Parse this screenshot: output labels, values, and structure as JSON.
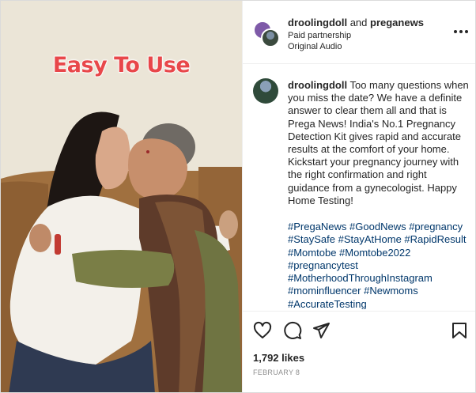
{
  "media": {
    "overlay_text": "Easy To Use"
  },
  "header": {
    "account_primary": "droolingdoll",
    "joiner": " and ",
    "account_secondary": "preganews",
    "paid_label": "Paid partnership",
    "audio_label": "Original Audio",
    "more_icon": "more-horizontal-icon"
  },
  "caption": {
    "username": "droolingdoll",
    "text": " Too many questions when you miss the date? We have a definite answer to clear them all and that is Prega News! India's No.1 Pregnancy Detection Kit gives rapid and accurate results at the comfort of your home. Kickstart your pregnancy journey with the right confirmation and right guidance from a gynecologist. Happy Home Testing!",
    "hashtags": "#PregaNews #GoodNews #pregnancy #StaySafe #StayAtHome #RapidResult #Momtobe #Momtobe2022 #pregnancytest #MotherhoodThroughInstagram #mominfluencer #Newmoms #AccurateTesting"
  },
  "actions": {
    "icons": [
      "heart-icon",
      "comment-icon",
      "share-icon",
      "bookmark-icon"
    ],
    "likes": "1,792 likes",
    "date": "FEBRUARY 8"
  },
  "colors": {
    "overlay_red": "#e8474a",
    "hashtag_blue": "#00376b",
    "secondary_text": "#8e8e8e",
    "border": "#dbdbdb"
  }
}
